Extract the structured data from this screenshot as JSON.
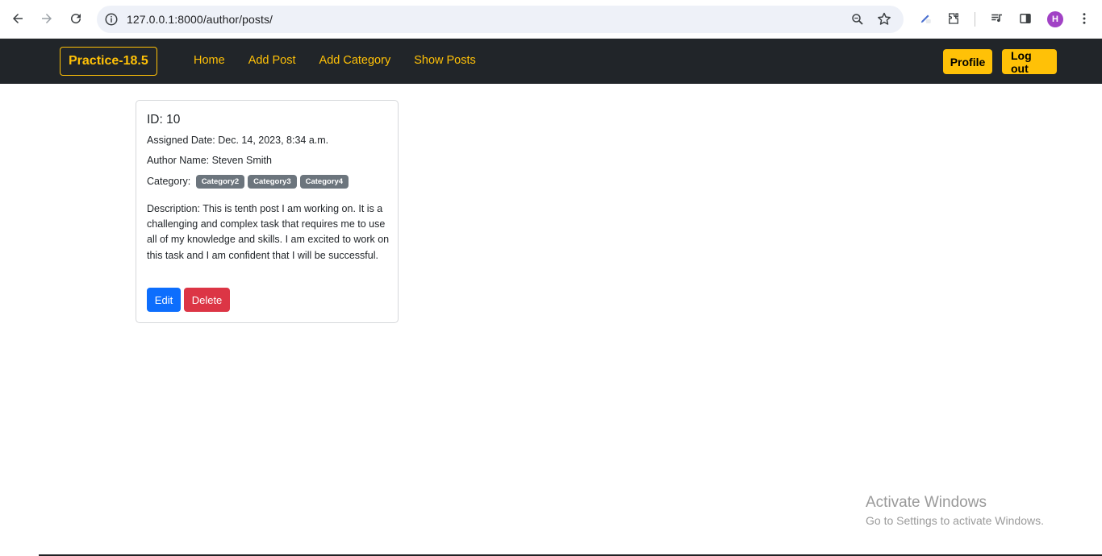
{
  "browser": {
    "url": "127.0.0.1:8000/author/posts/",
    "avatar_letter": "H"
  },
  "navbar": {
    "brand": "Practice-18.5",
    "links": [
      "Home",
      "Add Post",
      "Add Category",
      "Show Posts"
    ],
    "profile_label": "Profile",
    "logout_label": "Log out",
    "accent": "#ffc107",
    "background": "#212529"
  },
  "post": {
    "id_text": "ID: 10",
    "assigned_date": "Assigned Date: Dec. 14, 2023, 8:34 a.m.",
    "author": "Author Name: Steven Smith",
    "category_label": "Category:",
    "categories": [
      "Category2",
      "Category3",
      "Category4"
    ],
    "description": "Description: This is tenth post I am working on. It is a challenging and complex task that requires me to use all of my knowledge and skills. I am excited to work on this task and I am confident that I will be successful.",
    "edit_label": "Edit",
    "delete_label": "Delete"
  },
  "watermark": {
    "title": "Activate Windows",
    "subtitle": "Go to Settings to activate Windows."
  }
}
